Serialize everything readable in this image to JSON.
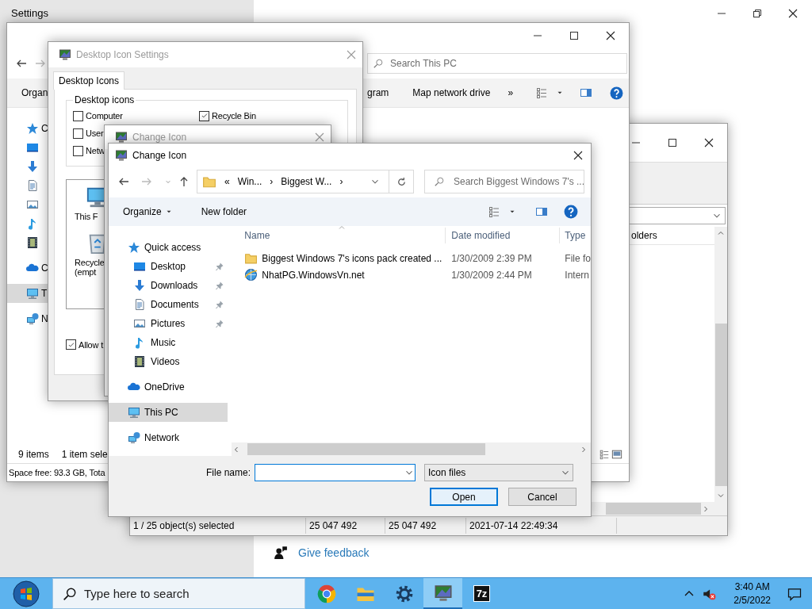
{
  "settings": {
    "title": "Settings",
    "feedback_link": "Give feedback"
  },
  "seven_zip_window": {
    "column_header": "olders",
    "status_bar": [
      "1 / 25 object(s) selected",
      "25 047 492",
      "25 047 492",
      "2021-07-14 22:49:34"
    ]
  },
  "explorer_window": {
    "search_placeholder": "Search This PC",
    "toolbar": [
      {
        "label": "Organ"
      },
      {
        "label": "gram"
      },
      {
        "label": "Map network drive"
      },
      {
        "label": "»"
      }
    ],
    "nav_items": [
      {
        "kind": "star",
        "label": "C",
        "selected": false
      },
      {
        "kind": "desktop",
        "selected": false
      },
      {
        "kind": "downloads",
        "selected": false
      },
      {
        "kind": "documents",
        "selected": false
      },
      {
        "kind": "pictures",
        "selected": false
      },
      {
        "kind": "music",
        "selected": false
      },
      {
        "kind": "videos",
        "selected": false
      },
      {
        "kind": "onedrive",
        "label": "C",
        "selected": false
      },
      {
        "kind": "pc",
        "label": "T",
        "selected": true
      },
      {
        "kind": "network",
        "label": "N",
        "selected": false
      }
    ],
    "status_count": "9 items",
    "status_selection": "1 item sele",
    "space": "Space free: 93.3 GB, Tota"
  },
  "desktop_icon_settings": {
    "title": "Desktop Icon Settings",
    "tabs": [
      {
        "label": "Desktop Icons",
        "selected": true
      }
    ],
    "group_label": "Desktop icons",
    "checkboxes": [
      {
        "label": "Computer",
        "checked": false
      },
      {
        "label": "User",
        "checked": false
      },
      {
        "label": "Netw",
        "checked": false
      },
      {
        "label": "Recycle Bin",
        "checked": true
      }
    ],
    "previews": [
      {
        "kind": "pc",
        "lines": [
          "This F"
        ]
      },
      {
        "kind": "recycle_bin",
        "lines": [
          "Recycle",
          "(empt"
        ]
      }
    ],
    "allow_option": {
      "label": "Allow t",
      "checked": true
    }
  },
  "change_icon_behind": {
    "title": "Change Icon"
  },
  "file_dialog": {
    "title": "Change Icon",
    "breadcrumb": [
      "«",
      "Win...",
      "›",
      "Biggest W...",
      "›"
    ],
    "search_placeholder": "Search Biggest Windows 7's ...",
    "toolbar": {
      "organize": "Organize",
      "new_folder": "New folder"
    },
    "nav_groups": [
      {
        "kind": "star",
        "label": "Quick access",
        "selected": false,
        "children": [
          {
            "kind": "desktop",
            "label": "Desktop",
            "pinned": true,
            "selected": false
          },
          {
            "kind": "downloads",
            "label": "Downloads",
            "pinned": true,
            "selected": false
          },
          {
            "kind": "documents",
            "label": "Documents",
            "pinned": true,
            "selected": false
          },
          {
            "kind": "pictures",
            "label": "Pictures",
            "pinned": true,
            "selected": false
          },
          {
            "kind": "music",
            "label": "Music",
            "pinned": false,
            "selected": false
          },
          {
            "kind": "videos",
            "label": "Videos",
            "pinned": false,
            "selected": false
          }
        ]
      },
      {
        "kind": "onedrive",
        "label": "OneDrive",
        "selected": false
      },
      {
        "kind": "pc",
        "label": "This PC",
        "selected": true
      },
      {
        "kind": "network",
        "label": "Network",
        "selected": false
      }
    ],
    "columns": [
      "Name",
      "Date modified",
      "Type"
    ],
    "rows": [
      {
        "kind": "folder",
        "name": "Biggest Windows 7's icons pack created ...",
        "date": "1/30/2009 2:39 PM",
        "type": "File fo"
      },
      {
        "kind": "link",
        "name": "NhatPG.WindowsVn.net",
        "date": "1/30/2009 2:44 PM",
        "type": "Intern"
      }
    ],
    "file_name_label": "File name:",
    "file_type": "Icon files",
    "buttons": [
      {
        "label": "Open",
        "default": true
      },
      {
        "label": "Cancel",
        "default": false
      }
    ]
  },
  "taskbar": {
    "search_placeholder": "Type here to search",
    "apps": [
      {
        "kind": "chrome",
        "selected": false
      },
      {
        "kind": "explorer",
        "selected": false
      },
      {
        "kind": "settings",
        "selected": false
      },
      {
        "kind": "desktop_icons",
        "selected": true
      },
      {
        "kind": "sevenzip",
        "label": "7z",
        "selected": false
      }
    ],
    "time": "3:40 AM",
    "date": "2/5/2022"
  }
}
